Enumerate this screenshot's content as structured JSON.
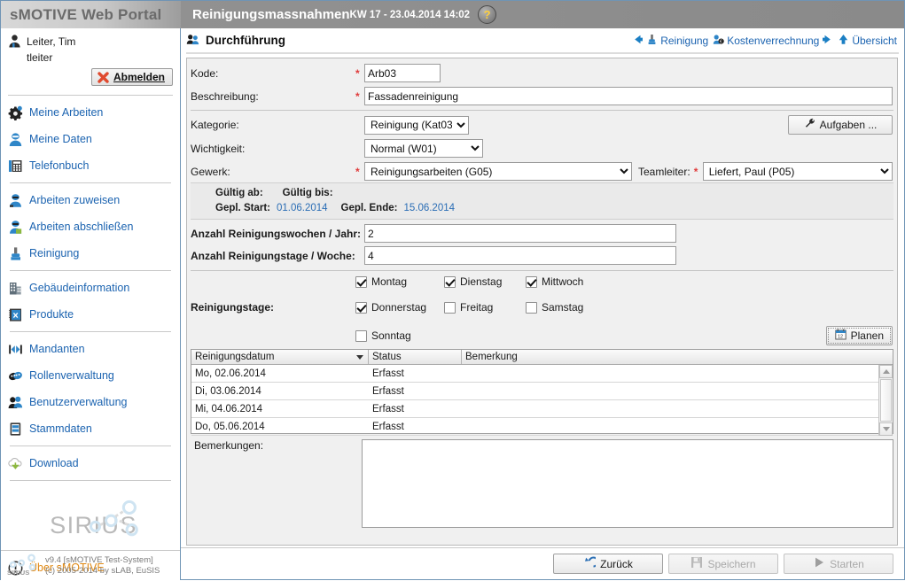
{
  "header": {
    "brand": "sMOTIVE Web Portal",
    "title": "Reinigungsmassnahmen",
    "clock": "KW 17 - 23.04.2014 14:02",
    "help_label": "?"
  },
  "sidebar": {
    "user_name": "Leiter, Tim",
    "user_login": "tleiter",
    "logout_label": "Abmelden",
    "groups": [
      {
        "items": [
          {
            "label": "Meine Arbeiten",
            "icon": "gear-icon"
          },
          {
            "label": "Meine Daten",
            "icon": "user-data-icon"
          },
          {
            "label": "Telefonbuch",
            "icon": "phonebook-icon"
          }
        ]
      },
      {
        "items": [
          {
            "label": "Arbeiten zuweisen",
            "icon": "assign-work-icon"
          },
          {
            "label": "Arbeiten abschließen",
            "icon": "complete-work-icon"
          },
          {
            "label": "Reinigung",
            "icon": "cleaning-icon"
          }
        ]
      },
      {
        "items": [
          {
            "label": "Gebäudeinformation",
            "icon": "building-icon"
          },
          {
            "label": "Produkte",
            "icon": "products-icon"
          }
        ]
      },
      {
        "items": [
          {
            "label": "Mandanten",
            "icon": "clients-icon"
          },
          {
            "label": "Rollenverwaltung",
            "icon": "roles-icon"
          },
          {
            "label": "Benutzerverwaltung",
            "icon": "users-icon"
          },
          {
            "label": "Stammdaten",
            "icon": "masterdata-icon"
          }
        ]
      },
      {
        "items": [
          {
            "label": "Download",
            "icon": "download-icon"
          }
        ]
      }
    ],
    "logo_text": "SIRIUS",
    "about_label": "Über sMOTIVE",
    "footer_line1": "v9.4 [sMOTIVE Test-System]",
    "footer_line2": "(c) 2005-2014 by sLAB, EuSIS"
  },
  "main": {
    "section_title": "Durchführung",
    "toolbar_links": [
      {
        "label": "Reinigung",
        "icon": "arrow-left-icon",
        "arrow": "left"
      },
      {
        "label": "Kostenverrechnung",
        "icon": "cost-icon",
        "arrow": "right"
      },
      {
        "label": "Übersicht",
        "icon": "arrow-up-icon",
        "arrow": "none"
      }
    ],
    "fields": {
      "kode_label": "Kode:",
      "kode_value": "Arb03",
      "beschreibung_label": "Beschreibung:",
      "beschreibung_value": "Fassadenreinigung",
      "kategorie_label": "Kategorie:",
      "kategorie_value": "Reinigung (Kat03)",
      "wichtigkeit_label": "Wichtigkeit:",
      "wichtigkeit_value": "Normal (W01)",
      "gewerk_label": "Gewerk:",
      "gewerk_value": "Reinigungsarbeiten (G05)",
      "teamleiter_label": "Teamleiter:",
      "teamleiter_value": "Liefert, Paul (P05)",
      "aufgaben_label": "Aufgaben ...",
      "required_marker": "*"
    },
    "validity": {
      "gueltig_ab_label": "Gültig ab:",
      "gueltig_ab_value": "",
      "gueltig_bis_label": "Gültig bis:",
      "gueltig_bis_value": "",
      "gepl_start_label": "Gepl. Start:",
      "gepl_start_value": "01.06.2014",
      "gepl_ende_label": "Gepl. Ende:",
      "gepl_ende_value": "15.06.2014"
    },
    "counts": {
      "wochen_label": "Anzahl Reinigungswochen / Jahr:",
      "wochen_value": "2",
      "tage_label": "Anzahl Reinigungstage / Woche:",
      "tage_value": "4"
    },
    "cleaning_days": {
      "label": "Reinigungstage:",
      "plan_label": "Planen",
      "days": [
        {
          "label": "Montag",
          "checked": true
        },
        {
          "label": "Dienstag",
          "checked": true
        },
        {
          "label": "Mittwoch",
          "checked": true
        },
        {
          "label": "Donnerstag",
          "checked": true
        },
        {
          "label": "Freitag",
          "checked": false
        },
        {
          "label": "Samstag",
          "checked": false
        },
        {
          "label": "Sonntag",
          "checked": false
        }
      ]
    },
    "table": {
      "columns": [
        "Reinigungsdatum",
        "Status",
        "Bemerkung"
      ],
      "sorted_column": 0,
      "rows": [
        {
          "date": "Mo, 02.06.2014",
          "status": "Erfasst",
          "note": ""
        },
        {
          "date": "Di, 03.06.2014",
          "status": "Erfasst",
          "note": ""
        },
        {
          "date": "Mi, 04.06.2014",
          "status": "Erfasst",
          "note": ""
        },
        {
          "date": "Do, 05.06.2014",
          "status": "Erfasst",
          "note": ""
        }
      ]
    },
    "remarks": {
      "label": "Bemerkungen:",
      "value": ""
    },
    "footer_buttons": [
      {
        "label": "Zurück",
        "icon": "back-arrow-icon",
        "enabled": true
      },
      {
        "label": "Speichern",
        "icon": "save-icon",
        "enabled": false
      },
      {
        "label": "Starten",
        "icon": "play-icon",
        "enabled": false
      }
    ]
  },
  "colors": {
    "accent_link": "#1b63b0",
    "required": "#e03b3b",
    "header_bg": "#8d8d8d",
    "date_text": "#2a6db5",
    "warn": "#e08a16"
  }
}
